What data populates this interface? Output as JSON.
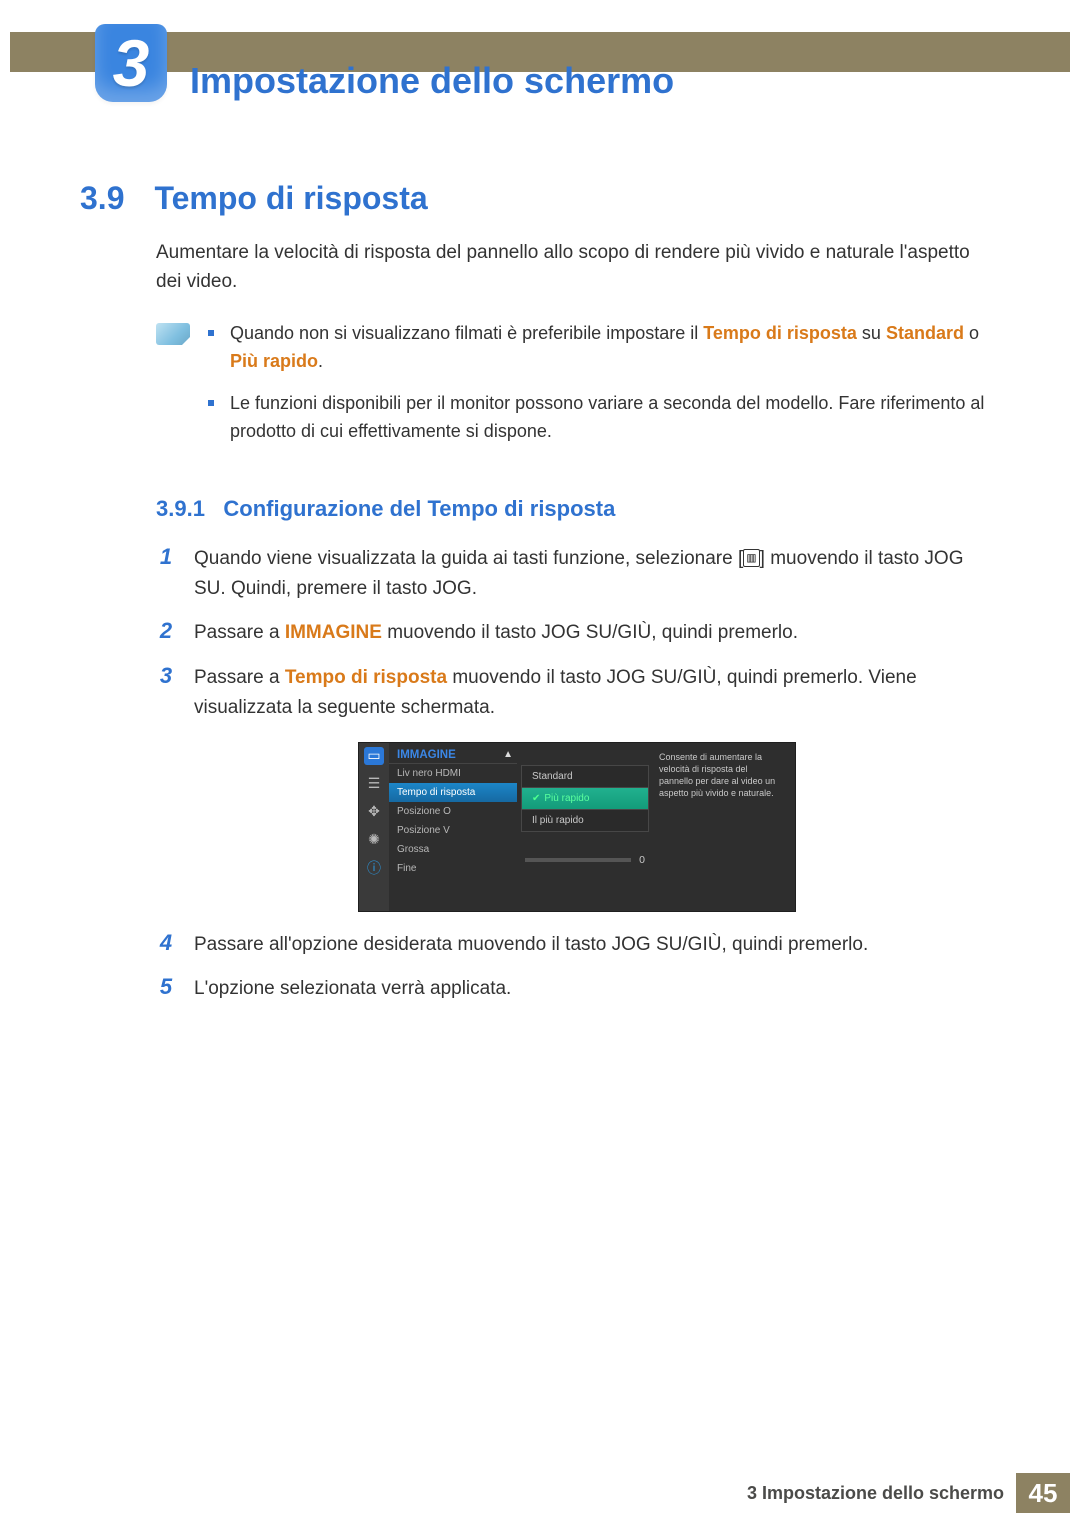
{
  "chapter": {
    "number": "3",
    "title": "Impostazione dello schermo"
  },
  "section": {
    "number": "3.9",
    "title": "Tempo di risposta",
    "intro": "Aumentare la velocità di risposta del pannello allo scopo di rendere più vivido e naturale l'aspetto dei video."
  },
  "notes": {
    "b1_pre": "Quando non si visualizzano filmati è preferibile impostare il ",
    "b1_hl1": "Tempo di risposta",
    "b1_mid": " su ",
    "b1_hl2": "Standard",
    "b1_or": " o ",
    "b1_hl3": "Più rapido",
    "b1_end": ".",
    "b2": "Le funzioni disponibili per il monitor possono variare a seconda del modello. Fare riferimento al prodotto di cui effettivamente si dispone."
  },
  "subsection": {
    "number": "3.9.1",
    "title": "Configurazione del Tempo di risposta"
  },
  "steps": {
    "s1a": "Quando viene visualizzata la guida ai tasti funzione, selezionare [",
    "s1b": "] muovendo il tasto JOG SU. Quindi, premere il tasto JOG.",
    "menu_glyph": "▥",
    "s2_pre": "Passare a ",
    "s2_hl": "IMMAGINE",
    "s2_post": " muovendo il tasto JOG SU/GIÙ, quindi premerlo.",
    "s3_pre": "Passare a ",
    "s3_hl": "Tempo di risposta",
    "s3_post": " muovendo il tasto JOG SU/GIÙ, quindi premerlo. Viene visualizzata la seguente schermata.",
    "s4": "Passare all'opzione desiderata muovendo il tasto JOG SU/GIÙ, quindi premerlo.",
    "s5": "L'opzione selezionata verrà applicata."
  },
  "osd": {
    "header": "IMMAGINE",
    "items": [
      "Liv nero HDMI",
      "Tempo di risposta",
      "Posizione O",
      "Posizione V",
      "Grossa",
      "Fine"
    ],
    "options": [
      "Standard",
      "Più rapido",
      "Il più rapido"
    ],
    "slider_value": "0",
    "help": "Consente di aumentare la velocità di risposta del pannello per dare al video un aspetto più vivido e naturale."
  },
  "footer": {
    "text": "3 Impostazione dello schermo",
    "page": "45"
  }
}
